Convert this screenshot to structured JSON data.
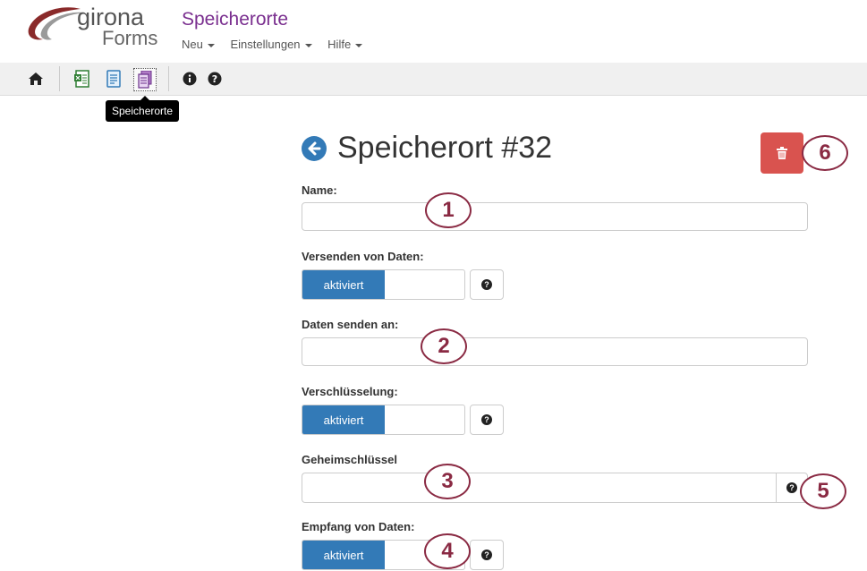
{
  "header": {
    "logo_line1": "girona",
    "logo_line2": "Forms",
    "title": "Speicherorte",
    "nav": [
      {
        "label": "Neu"
      },
      {
        "label": "Einstellungen"
      },
      {
        "label": "Hilfe"
      }
    ]
  },
  "toolbar": {
    "tooltip": "Speicherorte",
    "icons": [
      "home-icon",
      "spreadsheet-icon",
      "form-icon",
      "storage-locations-icon",
      "info-icon",
      "help-icon"
    ]
  },
  "form": {
    "title": "Speicherort #32",
    "fields": {
      "name_label": "Name:",
      "name_value": "",
      "send_label": "Versenden von Daten:",
      "send_toggle": "aktiviert",
      "send_to_label": "Daten senden an:",
      "send_to_value": "",
      "encryption_label": "Verschlüsselung:",
      "encryption_toggle": "aktiviert",
      "secret_label": "Geheimschlüssel",
      "secret_value": "",
      "receive_label": "Empfang von Daten:",
      "receive_toggle": "aktiviert"
    }
  },
  "callouts": [
    "1",
    "2",
    "3",
    "4",
    "5",
    "6"
  ],
  "colors": {
    "primary": "#337ab7",
    "danger": "#d9534f",
    "brand": "#7a2f8f",
    "callout": "#8a2a43"
  }
}
